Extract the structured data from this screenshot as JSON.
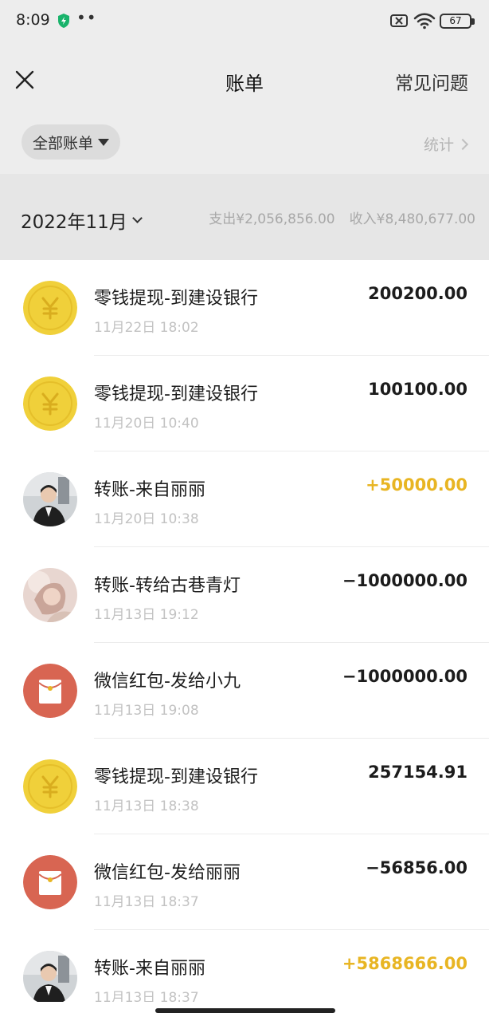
{
  "status_bar": {
    "time": "8:09",
    "battery": "67",
    "icons": [
      "shield-icon",
      "dots-icon",
      "sim-x-icon",
      "wifi-icon",
      "battery-icon"
    ]
  },
  "nav": {
    "title": "账单",
    "faq_label": "常见问题",
    "close_icon": "close-icon"
  },
  "filter": {
    "chip_label": "全部账单",
    "stats_label": "统计"
  },
  "month": {
    "label": "2022年11月",
    "expense": "支出¥2,056,856.00",
    "income": "收入¥8,480,677.00"
  },
  "colors": {
    "income": "#e8b523",
    "coin": "#f0d03a",
    "red_packet": "#d86552"
  },
  "transactions": [
    {
      "icon": "coin-icon",
      "title": "零钱提现-到建设银行",
      "time": "11月22日 18:02",
      "amount": "200200.00",
      "type": "expense"
    },
    {
      "icon": "coin-icon",
      "title": "零钱提现-到建设银行",
      "time": "11月20日 10:40",
      "amount": "100100.00",
      "type": "expense"
    },
    {
      "icon": "avatar-photo",
      "title": "转账-来自丽丽",
      "time": "11月20日 10:38",
      "amount": "+50000.00",
      "type": "income"
    },
    {
      "icon": "avatar-photo-2",
      "title": "转账-转给古巷青灯",
      "time": "11月13日 19:12",
      "amount": "−1000000.00",
      "type": "expense"
    },
    {
      "icon": "red-packet-icon",
      "title": "微信红包-发给小九",
      "time": "11月13日 19:08",
      "amount": "−1000000.00",
      "type": "expense"
    },
    {
      "icon": "coin-icon",
      "title": "零钱提现-到建设银行",
      "time": "11月13日 18:38",
      "amount": "257154.91",
      "type": "expense"
    },
    {
      "icon": "red-packet-icon",
      "title": "微信红包-发给丽丽",
      "time": "11月13日 18:37",
      "amount": "−56856.00",
      "type": "expense"
    },
    {
      "icon": "avatar-photo",
      "title": "转账-来自丽丽",
      "time": "11月13日 18:37",
      "amount": "+5868666.00",
      "type": "income"
    }
  ]
}
